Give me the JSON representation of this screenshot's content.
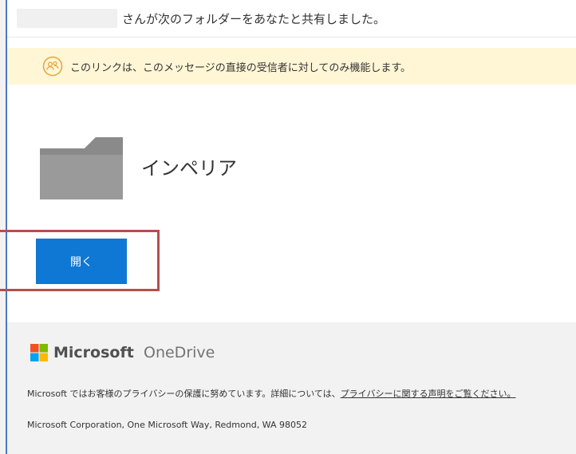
{
  "header": {
    "shared_message": "さんが次のフォルダーをあなたと共有しました。"
  },
  "notice": {
    "icon": "people-icon",
    "text": "このリンクは、このメッセージの直接の受信者に対してのみ機能します。",
    "background_color": "#fff6d6"
  },
  "folder": {
    "icon": "folder-icon",
    "name": "インペリア"
  },
  "actions": {
    "open_label": "開く",
    "accent_color": "#0f78d4"
  },
  "footer": {
    "brand": "Microsoft",
    "product": "OneDrive",
    "privacy_text_prefix": "Microsoft ではお客様のプライバシーの保護に努めています。詳細については、",
    "privacy_link_text": "プライバシーに関する声明をご覧ください。",
    "address": "Microsoft Corporation, One Microsoft Way, Redmond, WA 98052"
  },
  "annotation": {
    "highlight_color": "#b74d4d"
  }
}
